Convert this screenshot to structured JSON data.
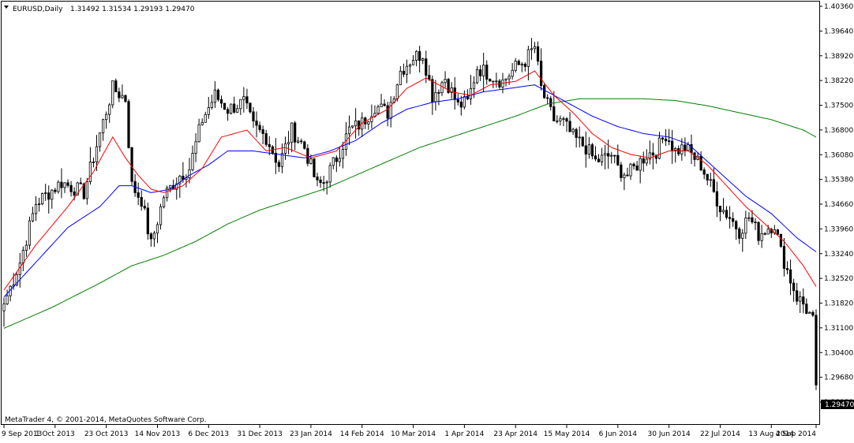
{
  "window": {
    "symbol_label": "EURUSD,Daily",
    "ohlc_text": "1.31492 1.31534 1.29193 1.29470",
    "copyright": "MetaTrader 4, © 2001-2014, MetaQuotes Software Corp.",
    "dropdown_icon": "triangle-down-icon"
  },
  "colors": {
    "background": "#ffffff",
    "candle_bull": "#ffffff",
    "candle_bear": "#000000",
    "candle_outline": "#000000",
    "ma_fast": "#ff0000",
    "ma_medium": "#0000ff",
    "ma_slow": "#008000",
    "price_tag_bg": "#000000",
    "price_tag_fg": "#ffffff"
  },
  "chart_data": {
    "type": "candlestick",
    "symbol": "EURUSD",
    "timeframe": "Daily",
    "y_ticks": [
      "1.40360",
      "1.39640",
      "1.38920",
      "1.38220",
      "1.37500",
      "1.36800",
      "1.36080",
      "1.35380",
      "1.34660",
      "1.33960",
      "1.33240",
      "1.32520",
      "1.31820",
      "1.31100",
      "1.30400",
      "1.29680",
      "1.28980"
    ],
    "ylim": [
      1.2898,
      1.4036
    ],
    "current_price": "1.29470",
    "x_labels": [
      "9 Sep 2013",
      "1 Oct 2013",
      "23 Oct 2013",
      "14 Nov 2013",
      "6 Dec 2013",
      "31 Dec 2013",
      "23 Jan 2014",
      "14 Feb 2014",
      "10 Mar 2014",
      "1 Apr 2014",
      "23 Apr 2014",
      "15 May 2014",
      "6 Jun 2014",
      "30 Jun 2014",
      "22 Jul 2014",
      "13 Aug 2014",
      "4 Sep 2014"
    ],
    "x_label_bar_index": [
      0,
      16,
      32,
      48,
      64,
      80,
      96,
      112,
      128,
      144,
      160,
      176,
      192,
      208,
      224,
      240,
      254
    ],
    "close_anchors": [
      [
        0,
        1.318
      ],
      [
        5,
        1.33
      ],
      [
        10,
        1.347
      ],
      [
        18,
        1.353
      ],
      [
        25,
        1.35
      ],
      [
        30,
        1.367
      ],
      [
        34,
        1.38
      ],
      [
        38,
        1.377
      ],
      [
        40,
        1.352
      ],
      [
        43,
        1.348
      ],
      [
        46,
        1.335
      ],
      [
        50,
        1.349
      ],
      [
        55,
        1.355
      ],
      [
        58,
        1.357
      ],
      [
        62,
        1.371
      ],
      [
        66,
        1.378
      ],
      [
        70,
        1.374
      ],
      [
        75,
        1.376
      ],
      [
        78,
        1.369
      ],
      [
        82,
        1.366
      ],
      [
        86,
        1.358
      ],
      [
        90,
        1.368
      ],
      [
        94,
        1.363
      ],
      [
        98,
        1.352
      ],
      [
        100,
        1.353
      ],
      [
        104,
        1.36
      ],
      [
        108,
        1.368
      ],
      [
        112,
        1.37
      ],
      [
        116,
        1.375
      ],
      [
        120,
        1.373
      ],
      [
        124,
        1.385
      ],
      [
        128,
        1.389
      ],
      [
        131,
        1.39
      ],
      [
        134,
        1.378
      ],
      [
        138,
        1.383
      ],
      [
        142,
        1.375
      ],
      [
        145,
        1.376
      ],
      [
        148,
        1.386
      ],
      [
        152,
        1.384
      ],
      [
        156,
        1.382
      ],
      [
        160,
        1.386
      ],
      [
        163,
        1.388
      ],
      [
        166,
        1.392
      ],
      [
        168,
        1.38
      ],
      [
        170,
        1.375
      ],
      [
        172,
        1.371
      ],
      [
        175,
        1.37
      ],
      [
        178,
        1.366
      ],
      [
        182,
        1.363
      ],
      [
        185,
        1.359
      ],
      [
        188,
        1.36
      ],
      [
        190,
        1.361
      ],
      [
        192,
        1.357
      ],
      [
        195,
        1.355
      ],
      [
        198,
        1.358
      ],
      [
        201,
        1.361
      ],
      [
        204,
        1.362
      ],
      [
        207,
        1.367
      ],
      [
        210,
        1.362
      ],
      [
        213,
        1.363
      ],
      [
        216,
        1.36
      ],
      [
        218,
        1.358
      ],
      [
        221,
        1.352
      ],
      [
        224,
        1.346
      ],
      [
        227,
        1.343
      ],
      [
        230,
        1.339
      ],
      [
        233,
        1.343
      ],
      [
        236,
        1.338
      ],
      [
        239,
        1.34
      ],
      [
        241,
        1.341
      ],
      [
        243,
        1.333
      ],
      [
        246,
        1.325
      ],
      [
        248,
        1.32
      ],
      [
        250,
        1.318
      ],
      [
        252,
        1.315
      ],
      [
        253,
        1.313
      ],
      [
        254,
        1.2947
      ]
    ],
    "ma_fast_anchors": [
      [
        0,
        1.322
      ],
      [
        10,
        1.335
      ],
      [
        20,
        1.346
      ],
      [
        28,
        1.356
      ],
      [
        34,
        1.366
      ],
      [
        38,
        1.36
      ],
      [
        42,
        1.355
      ],
      [
        46,
        1.351
      ],
      [
        50,
        1.35
      ],
      [
        56,
        1.352
      ],
      [
        62,
        1.357
      ],
      [
        68,
        1.366
      ],
      [
        76,
        1.368
      ],
      [
        82,
        1.362
      ],
      [
        88,
        1.363
      ],
      [
        96,
        1.36
      ],
      [
        104,
        1.362
      ],
      [
        112,
        1.37
      ],
      [
        120,
        1.374
      ],
      [
        126,
        1.38
      ],
      [
        132,
        1.383
      ],
      [
        140,
        1.379
      ],
      [
        146,
        1.378
      ],
      [
        152,
        1.381
      ],
      [
        160,
        1.382
      ],
      [
        166,
        1.385
      ],
      [
        172,
        1.378
      ],
      [
        178,
        1.373
      ],
      [
        184,
        1.367
      ],
      [
        190,
        1.363
      ],
      [
        196,
        1.361
      ],
      [
        202,
        1.36
      ],
      [
        208,
        1.362
      ],
      [
        214,
        1.362
      ],
      [
        220,
        1.358
      ],
      [
        226,
        1.352
      ],
      [
        232,
        1.346
      ],
      [
        238,
        1.341
      ],
      [
        244,
        1.336
      ],
      [
        250,
        1.329
      ],
      [
        254,
        1.323
      ]
    ],
    "ma_medium_anchors": [
      [
        0,
        1.32
      ],
      [
        10,
        1.33
      ],
      [
        20,
        1.34
      ],
      [
        30,
        1.346
      ],
      [
        36,
        1.352
      ],
      [
        40,
        1.352
      ],
      [
        46,
        1.35
      ],
      [
        52,
        1.351
      ],
      [
        58,
        1.355
      ],
      [
        64,
        1.358
      ],
      [
        70,
        1.362
      ],
      [
        78,
        1.362
      ],
      [
        86,
        1.361
      ],
      [
        94,
        1.36
      ],
      [
        102,
        1.362
      ],
      [
        110,
        1.365
      ],
      [
        118,
        1.37
      ],
      [
        126,
        1.374
      ],
      [
        134,
        1.376
      ],
      [
        142,
        1.377
      ],
      [
        150,
        1.379
      ],
      [
        158,
        1.38
      ],
      [
        166,
        1.381
      ],
      [
        172,
        1.378
      ],
      [
        178,
        1.375
      ],
      [
        184,
        1.372
      ],
      [
        192,
        1.369
      ],
      [
        200,
        1.367
      ],
      [
        208,
        1.366
      ],
      [
        214,
        1.364
      ],
      [
        220,
        1.359
      ],
      [
        226,
        1.354
      ],
      [
        232,
        1.349
      ],
      [
        240,
        1.344
      ],
      [
        248,
        1.337
      ],
      [
        254,
        1.333
      ]
    ],
    "ma_slow_anchors": [
      [
        0,
        1.311
      ],
      [
        15,
        1.317
      ],
      [
        30,
        1.324
      ],
      [
        40,
        1.329
      ],
      [
        50,
        1.332
      ],
      [
        60,
        1.336
      ],
      [
        70,
        1.341
      ],
      [
        80,
        1.345
      ],
      [
        90,
        1.348
      ],
      [
        100,
        1.351
      ],
      [
        110,
        1.355
      ],
      [
        120,
        1.359
      ],
      [
        130,
        1.363
      ],
      [
        140,
        1.366
      ],
      [
        150,
        1.369
      ],
      [
        160,
        1.372
      ],
      [
        170,
        1.3755
      ],
      [
        180,
        1.377
      ],
      [
        190,
        1.377
      ],
      [
        200,
        1.377
      ],
      [
        210,
        1.3765
      ],
      [
        220,
        1.375
      ],
      [
        230,
        1.373
      ],
      [
        240,
        1.371
      ],
      [
        250,
        1.368
      ],
      [
        254,
        1.366
      ]
    ]
  }
}
